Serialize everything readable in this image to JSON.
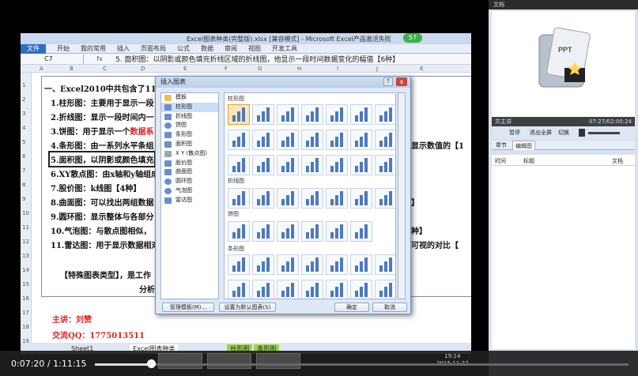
{
  "excel": {
    "title": "Excel图表种类(完整版).xlsx [兼容模式] - Microsoft Excel产品激活失败",
    "badge": "57",
    "ribbon_tabs": [
      "文件",
      "开始",
      "我的常用",
      "插入",
      "页面布局",
      "公式",
      "数据",
      "审阅",
      "视图",
      "开发工具"
    ],
    "name_box": "C7",
    "fx": "fx",
    "formula": "5. 面积图：以阴影或颜色填充折线区域的折线图，他显示一段时间数据变化的幅值【6种】",
    "columns": [
      "A",
      "B",
      "C",
      "D",
      "E",
      "F",
      "G",
      "H",
      "I",
      "J",
      "K"
    ],
    "rows": [
      "1",
      "2",
      "3",
      "4",
      "5",
      "6",
      "7",
      "8",
      "9",
      "10",
      "11",
      "12",
      "13",
      "14",
      "15",
      "16",
      "17",
      "18",
      "19",
      "20"
    ],
    "lines": [
      {
        "text": "一、Excel2010中共包含了11类"
      },
      {
        "text": "1.柱形图：主要用于显示一段"
      },
      {
        "text": "2.折线图：显示一段时间内一"
      },
      {
        "text": "3.饼图：用于显示一个",
        "red": "数据系"
      },
      {
        "text": "4.条形图：由一系列水平条组"
      },
      {
        "text": "5.面积图，以阴影或颜色填充"
      },
      {
        "text": "6.XY散点图：由x轴和y轴组成"
      },
      {
        "text": "7.股价图：k线图【4种】"
      },
      {
        "text": "8.曲面图：可以找出两组数据"
      },
      {
        "text": "9.圆环图：显示整体与各部分"
      },
      {
        "text": "10.气泡图：与散点图相似，"
      },
      {
        "text": "11.雷达图：用于显示数据相对"
      },
      {
        "text": "【特殊图表类型】，是工作"
      },
      {
        "text": "分析有"
      }
    ],
    "right_fragments": [
      "显示数值的【1",
      "】",
      "种】",
      "可视的对比【"
    ],
    "author": "主讲：刘赞",
    "qq": "交流QQ：1775013511",
    "sheet_tabs": [
      "Sheet1",
      "Excel图表种类",
      "柱形图",
      "条形图"
    ]
  },
  "dialog": {
    "title": "插入图表",
    "help": "?",
    "close": "x",
    "categories": [
      "模板",
      "柱形图",
      "折线图",
      "饼图",
      "条形图",
      "面积图",
      "X Y (散点图)",
      "股价图",
      "曲面图",
      "圆环图",
      "气泡图",
      "雷达图"
    ],
    "sections": [
      "柱形图",
      "折线图",
      "饼图",
      "条形图"
    ],
    "manage_button": "管理模板(M)...",
    "default_button": "设置为默认图表(S)",
    "ok_button": "确定",
    "cancel_button": "取消"
  },
  "right_panel": {
    "title": "文档",
    "ppt_label": "PPT",
    "status": "共主讲",
    "time": "07:27/02:00:24",
    "buttons": [
      "暂停",
      "退出全屏",
      "切换"
    ],
    "tabs": [
      "章节",
      "编辑图"
    ],
    "table_headers": [
      "时间",
      "标题",
      "文档"
    ]
  },
  "player": {
    "current": "0:07:20",
    "separator": "/",
    "total": "1:11:15",
    "progress": 0.1,
    "clock_time": "19:14",
    "clock_date": "2015-11-27"
  },
  "colors": {
    "accent": "#2a6fc4",
    "red": "#d22",
    "select": "#e2a12e"
  }
}
